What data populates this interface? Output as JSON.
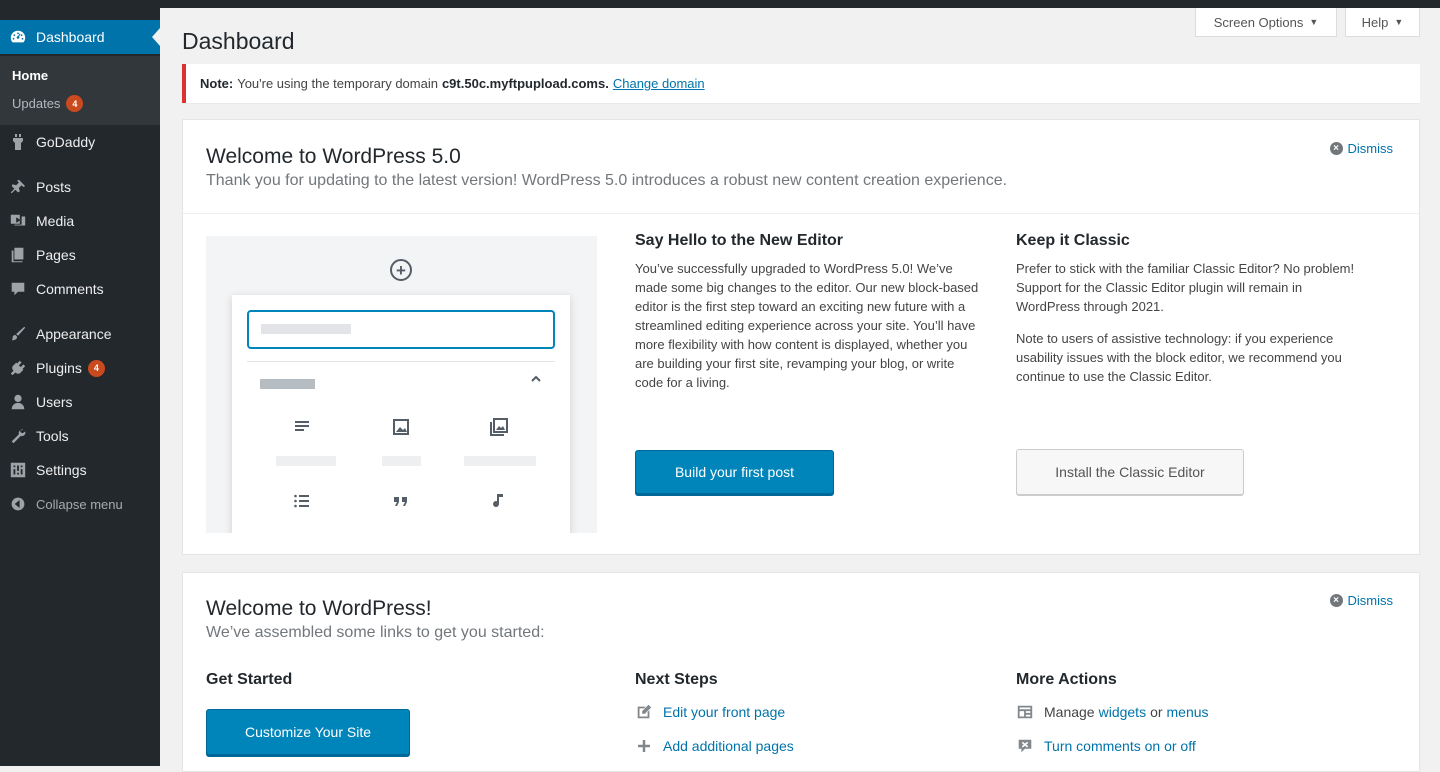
{
  "sidebar": {
    "dashboard": "Dashboard",
    "home": "Home",
    "updates": "Updates",
    "updates_count": "4",
    "godaddy": "GoDaddy",
    "posts": "Posts",
    "media": "Media",
    "pages": "Pages",
    "comments": "Comments",
    "appearance": "Appearance",
    "plugins": "Plugins",
    "plugins_count": "4",
    "users": "Users",
    "tools": "Tools",
    "settings": "Settings",
    "collapse": "Collapse menu"
  },
  "header": {
    "screen_options": "Screen Options",
    "help": "Help",
    "page_title": "Dashboard"
  },
  "notice": {
    "label": "Note:",
    "text": "You're using the temporary domain",
    "domain": "c9t.50c.myftpupload.com",
    "period": "s.",
    "link": "Change domain"
  },
  "welcome50": {
    "title": "Welcome to WordPress 5.0",
    "subtitle": "Thank you for updating to the latest version! WordPress 5.0 introduces a robust new content creation experience.",
    "dismiss": "Dismiss",
    "editor_heading": "Say Hello to the New Editor",
    "editor_text": "You’ve successfully upgraded to WordPress 5.0! We’ve made some big changes to the editor. Our new block-based editor is the first step toward an exciting new future with a streamlined editing experience across your site. You’ll have more flexibility with how content is displayed, whether you are building your first site, revamping your blog, or write code for a living.",
    "build_button": "Build your first post",
    "classic_heading": "Keep it Classic",
    "classic_text_1": "Prefer to stick with the familiar Classic Editor? No problem! Support for the Classic Editor plugin will remain in WordPress through 2021.",
    "classic_text_2": "Note to users of assistive technology: if you experience usability issues with the block editor, we recommend you continue to use the Classic Editor.",
    "install_button": "Install the Classic Editor"
  },
  "welcome": {
    "title": "Welcome to WordPress!",
    "subtitle": "We’ve assembled some links to get you started:",
    "dismiss": "Dismiss",
    "get_started": "Get Started",
    "customize_button": "Customize Your Site",
    "next_steps": "Next Steps",
    "edit_front": "Edit your front page",
    "add_pages": "Add additional pages",
    "more_actions": "More Actions",
    "manage": "Manage",
    "widgets": "widgets",
    "or": "or",
    "menus": "menus",
    "comments_toggle": "Turn comments on or off"
  },
  "colors": {
    "sidebar_bg": "#23282d",
    "accent": "#0073aa",
    "primary_button": "#0085ba",
    "badge": "#ca4a1f",
    "notice_error": "#dc3232"
  }
}
